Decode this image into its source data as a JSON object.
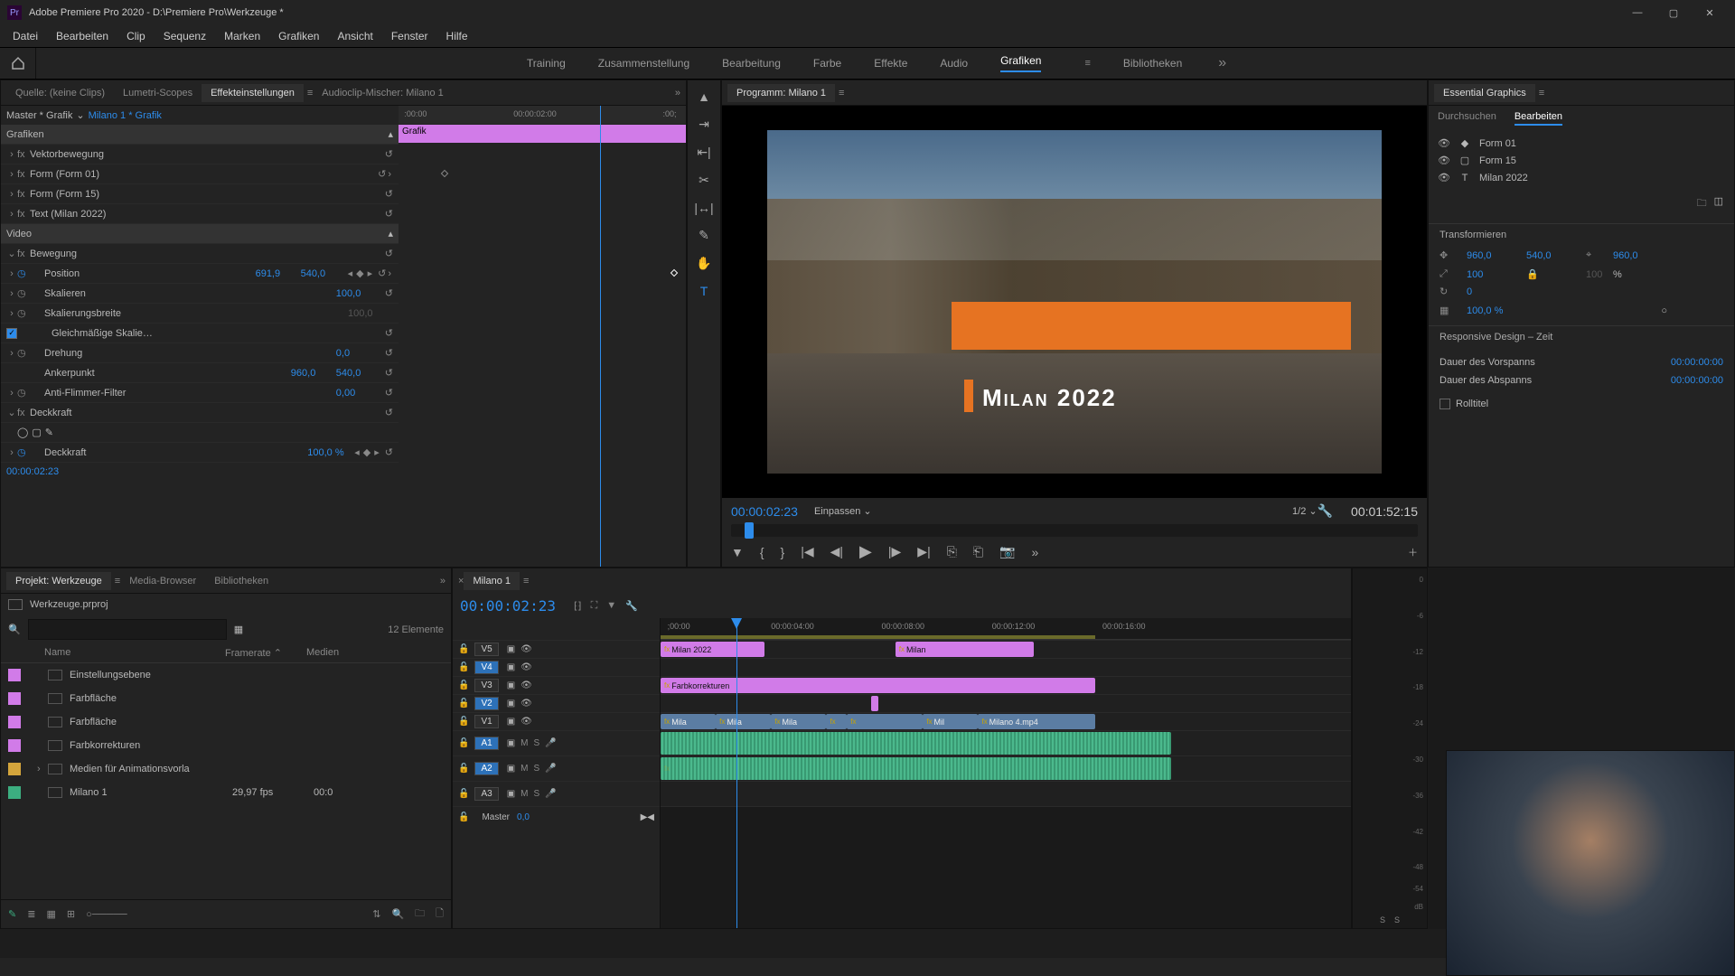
{
  "title": "Adobe Premiere Pro 2020 - D:\\Premiere Pro\\Werkzeuge *",
  "menu": [
    "Datei",
    "Bearbeiten",
    "Clip",
    "Sequenz",
    "Marken",
    "Grafiken",
    "Ansicht",
    "Fenster",
    "Hilfe"
  ],
  "workspaces": [
    "Training",
    "Zusammenstellung",
    "Bearbeitung",
    "Farbe",
    "Effekte",
    "Audio",
    "Grafiken",
    "Bibliotheken"
  ],
  "ws_active": "Grafiken",
  "source_panel": {
    "tabs": [
      "Quelle: (keine Clips)",
      "Lumetri-Scopes",
      "Effekteinstellungen",
      "Audioclip-Mischer: Milano 1"
    ],
    "active": "Effekteinstellungen",
    "master": "Master * Grafik",
    "clip": "Milano 1 * Grafik",
    "ruler": [
      ":00:00",
      "00:00:02:00",
      ":00;"
    ],
    "grafik_bar": "Grafik",
    "sections": {
      "grafiken": "Grafiken",
      "vektor": "Vektorbewegung",
      "form01": "Form (Form 01)",
      "form15": "Form (Form 15)",
      "text": "Text (Milan 2022)",
      "video": "Video",
      "bewegung": "Bewegung",
      "deckkraft": "Deckkraft"
    },
    "props": {
      "position": {
        "label": "Position",
        "x": "691,9",
        "y": "540,0"
      },
      "skalieren": {
        "label": "Skalieren",
        "v": "100,0"
      },
      "skalierungsbreite": {
        "label": "Skalierungsbreite",
        "v": "100,0"
      },
      "gleich": "Gleichmäßige Skalie…",
      "drehung": {
        "label": "Drehung",
        "v": "0,0"
      },
      "anker": {
        "label": "Ankerpunkt",
        "x": "960,0",
        "y": "540,0"
      },
      "antiflimmer": {
        "label": "Anti-Flimmer-Filter",
        "v": "0,00"
      },
      "deckkraft_val": {
        "label": "Deckkraft",
        "v": "100,0 %"
      }
    },
    "timecode": "00:00:02:23"
  },
  "program": {
    "tab": "Programm: Milano 1",
    "overlay_text": "Milan 2022",
    "tc_left": "00:00:02:23",
    "fit": "Einpassen",
    "res": "1/2",
    "tc_right": "00:01:52:15"
  },
  "project": {
    "tabs": [
      "Projekt: Werkzeuge",
      "Media-Browser",
      "Bibliotheken"
    ],
    "filename": "Werkzeuge.prproj",
    "count": "12 Elemente",
    "cols": {
      "name": "Name",
      "fps": "Framerate",
      "media": "Medien"
    },
    "items": [
      {
        "color": "#d17be8",
        "name": "Einstellungsebene",
        "fps": "",
        "dur": ""
      },
      {
        "color": "#d17be8",
        "name": "Farbfläche",
        "fps": "",
        "dur": ""
      },
      {
        "color": "#d17be8",
        "name": "Farbfläche",
        "fps": "",
        "dur": ""
      },
      {
        "color": "#d17be8",
        "name": "Farbkorrekturen",
        "fps": "",
        "dur": ""
      },
      {
        "color": "#d4a53c",
        "name": "Medien für Animationsvorla",
        "fps": "",
        "dur": "",
        "twisty": true
      },
      {
        "color": "#3cae80",
        "name": "Milano 1",
        "fps": "29,97 fps",
        "dur": "00:0"
      }
    ]
  },
  "timeline": {
    "tab": "Milano 1",
    "tc": "00:00:02:23",
    "ruler": [
      ";00:00",
      "00:00:04:00",
      "00:00:08:00",
      "00:00:12:00",
      "00:00:16:00"
    ],
    "tracks_v": [
      {
        "name": "V5",
        "sel": false
      },
      {
        "name": "V4",
        "sel": true
      },
      {
        "name": "V3",
        "sel": false
      },
      {
        "name": "V2",
        "sel": true
      },
      {
        "name": "V1",
        "sel": false
      }
    ],
    "tracks_a": [
      {
        "name": "A1",
        "sel": true
      },
      {
        "name": "A2",
        "sel": true
      },
      {
        "name": "A3",
        "sel": false
      }
    ],
    "master": {
      "name": "Master",
      "v": "0,0"
    },
    "clips": {
      "v5_a": "Milan 2022",
      "v5_b": "Milan",
      "v3": "Farbkorrekturen",
      "v1": [
        "Mila",
        "Mila",
        "Mila",
        "",
        "",
        "Mil",
        "Milano 4.mp4"
      ]
    }
  },
  "meters": {
    "scale": [
      "0",
      "-6",
      "-12",
      "-18",
      "-24",
      "-30",
      "-36",
      "-42",
      "-48",
      "-54",
      "dB"
    ],
    "ss": [
      "S",
      "S"
    ]
  },
  "ess": {
    "title": "Essential Graphics",
    "tabs": {
      "browse": "Durchsuchen",
      "edit": "Bearbeiten"
    },
    "layers": [
      {
        "type": "shape",
        "name": "Form 01"
      },
      {
        "type": "shape",
        "name": "Form 15"
      },
      {
        "type": "text",
        "name": "Milan 2022"
      }
    ],
    "transform": {
      "title": "Transformieren",
      "pos": {
        "x": "960,0",
        "y": "540,0"
      },
      "anchor": {
        "x": "960,0"
      },
      "scale": {
        "x": "100",
        "y": "100"
      },
      "pct": "%",
      "rot": "0",
      "opacity": "100,0 %"
    },
    "responsive": {
      "title": "Responsive Design – Zeit",
      "intro": {
        "label": "Dauer des Vorspanns",
        "v": "00:00:00:00"
      },
      "outro": {
        "label": "Dauer des Abspanns",
        "v": "00:00:00:00"
      },
      "roll": "Rolltitel"
    }
  }
}
